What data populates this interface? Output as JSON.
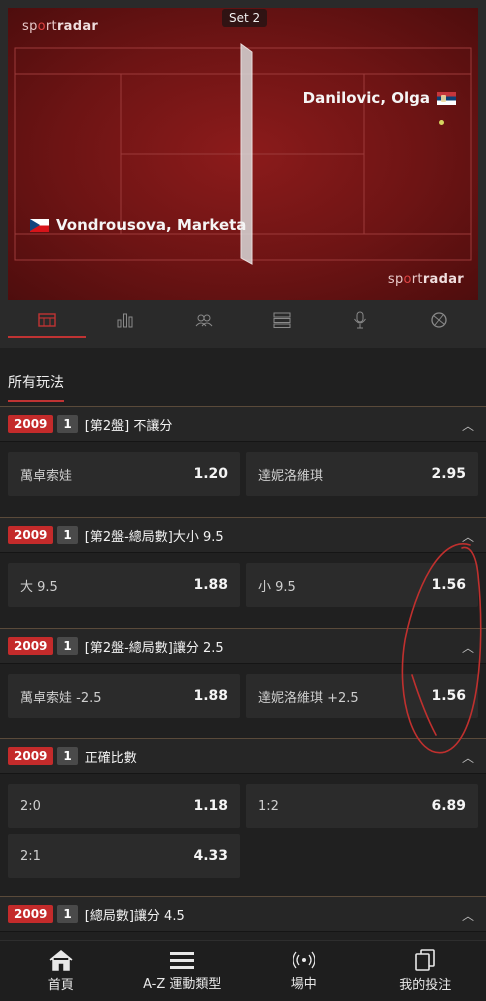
{
  "court": {
    "brand_prefix": "sp",
    "brand_mid": "rt",
    "brand_suffix": "radar",
    "set_label": "Set 2",
    "player1_name": "Vondrousova, Marketa",
    "player2_name": "Danilovic, Olga"
  },
  "tabs": [
    {
      "icon": "scoreboard-icon",
      "active": true
    },
    {
      "icon": "bar-chart-icon",
      "active": false
    },
    {
      "icon": "players-icon",
      "active": false
    },
    {
      "icon": "list-icon",
      "active": false
    },
    {
      "icon": "microphone-icon",
      "active": false
    },
    {
      "icon": "tennis-ball-icon",
      "active": false
    }
  ],
  "markets_tab": "所有玩法",
  "markets": [
    {
      "code": "2009",
      "num": "1",
      "title": "[第2盤] 不讓分",
      "odds": [
        {
          "label": "萬卓索娃",
          "value": "1.20"
        },
        {
          "label": "達妮洛維琪",
          "value": "2.95"
        }
      ]
    },
    {
      "code": "2009",
      "num": "1",
      "title": "[第2盤-總局數]大小 9.5",
      "odds": [
        {
          "label": "大 9.5",
          "value": "1.88"
        },
        {
          "label": "小 9.5",
          "value": "1.56"
        }
      ]
    },
    {
      "code": "2009",
      "num": "1",
      "title": "[第2盤-總局數]讓分 2.5",
      "odds": [
        {
          "label": "萬卓索娃 -2.5",
          "value": "1.88"
        },
        {
          "label": "達妮洛維琪 +2.5",
          "value": "1.56"
        }
      ]
    },
    {
      "code": "2009",
      "num": "1",
      "title": "正確比數",
      "odds": [
        {
          "label": "2:0",
          "value": "1.18"
        },
        {
          "label": "1:2",
          "value": "6.89"
        },
        {
          "label": "2:1",
          "value": "4.33"
        }
      ]
    },
    {
      "code": "2009",
      "num": "1",
      "title": "[總局數]讓分 4.5",
      "odds": []
    }
  ],
  "bottom_nav": [
    {
      "label": "首頁",
      "icon": "home-icon"
    },
    {
      "label": "A-Z 運動類型",
      "icon": "menu-icon"
    },
    {
      "label": "場中",
      "icon": "live-broadcast-icon"
    },
    {
      "label": "我的投注",
      "icon": "bet-slip-icon"
    }
  ],
  "colors": {
    "accent": "#c42b2b",
    "court": "#7a1717",
    "background": "#202020"
  }
}
